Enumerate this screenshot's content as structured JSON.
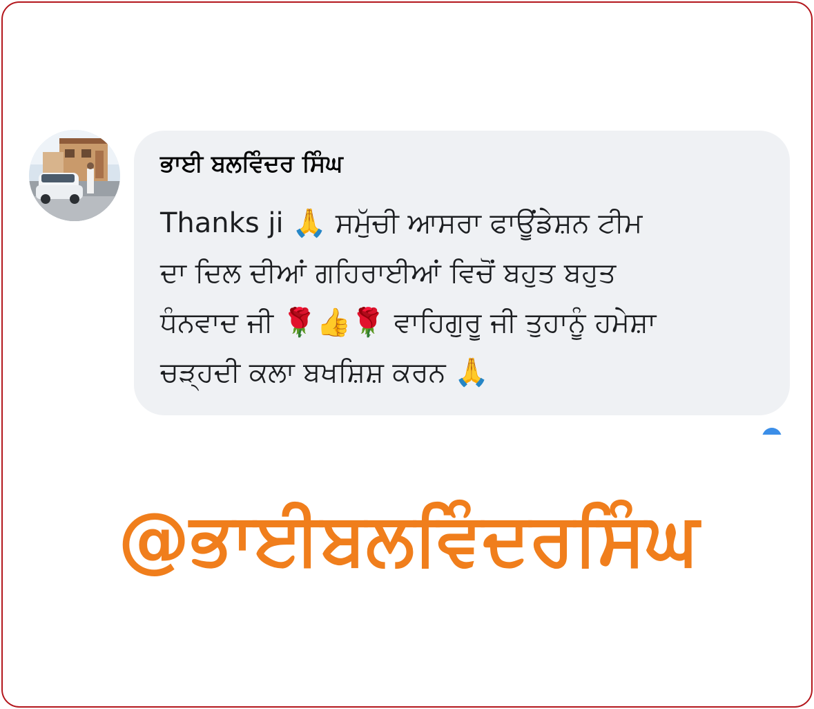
{
  "comment": {
    "sender_name": "ਭਾਈ ਬਲਵਿੰਦਰ ਸਿੰਘ",
    "message_lines": [
      "Thanks ji 🙏 ਸਮੁੱਚੀ ਆਸਰਾ ਫਾਊਂਡੇਸ਼ਨ ਟੀਮ",
      "ਦਾ ਦਿਲ ਦੀਆਂ ਗਹਿਰਾਈਆਂ ਵਿਚੋਂ ਬਹੁਤ ਬਹੁਤ",
      "ਧੰਨਵਾਦ ਜੀ 🌹👍🌹 ਵਾਹਿਗੁਰੂ ਜੀ ਤੁਹਾਨੂੰ ਹਮੇਸ਼ਾ",
      "ਚੜ੍ਹਦੀ ਕਲਾ ਬਖਸ਼ਿਸ਼ ਕਰਨ 🙏"
    ]
  },
  "hashtag": "@ਭਾਈਬਲਵਿੰਦਰਸਿੰਘ",
  "colors": {
    "frame_border": "#b3161c",
    "bubble_bg": "#eff1f4",
    "hashtag": "#f07e1c",
    "reaction_dot": "#3b8ee8"
  },
  "icons": {
    "avatar": "profile-photo",
    "corner_indicator": "reaction-dot-icon"
  }
}
